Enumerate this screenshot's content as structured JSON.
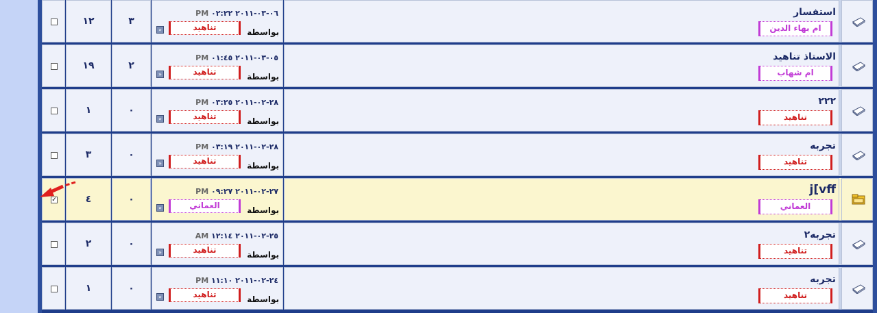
{
  "by_label": "بواسطة",
  "threads": [
    {
      "title": "استفسار",
      "author": "ام بهاء الدين",
      "author_color": "purple",
      "last_date": "٠٦-٠٣-٢٠١١ ٠٢:٢٢",
      "ampm": "PM",
      "last_poster": "تناهيد",
      "last_poster_color": "red",
      "views": "١٢",
      "replies": "٣",
      "checked": false,
      "highlighted": false,
      "icon": "thread-icon"
    },
    {
      "title": "الاستاذ تناهيد",
      "author": "ام شهاب",
      "author_color": "purple",
      "last_date": "٠٥-٠٣-٢٠١١ ٠١:٤٥",
      "ampm": "PM",
      "last_poster": "تناهيد",
      "last_poster_color": "red",
      "views": "١٩",
      "replies": "٢",
      "checked": false,
      "highlighted": false,
      "icon": "thread-icon"
    },
    {
      "title": "٢٢٢",
      "author": "تناهيد",
      "author_color": "red",
      "last_date": "٢٨-٠٢-٢٠١١ ٠٣:٢٥",
      "ampm": "PM",
      "last_poster": "تناهيد",
      "last_poster_color": "red",
      "views": "١",
      "replies": "٠",
      "checked": false,
      "highlighted": false,
      "icon": "thread-icon"
    },
    {
      "title": "تجربه",
      "author": "تناهيد",
      "author_color": "red",
      "last_date": "٢٨-٠٢-٢٠١١ ٠٣:١٩",
      "ampm": "PM",
      "last_poster": "تناهيد",
      "last_poster_color": "red",
      "views": "٣",
      "replies": "٠",
      "checked": false,
      "highlighted": false,
      "icon": "thread-icon"
    },
    {
      "title": "j[vff",
      "author": "العماني",
      "author_color": "purple",
      "last_date": "٢٧-٠٢-٢٠١١ ٠٩:٢٧",
      "ampm": "PM",
      "last_poster": "العماني",
      "last_poster_color": "purple",
      "views": "٤",
      "replies": "٠",
      "checked": true,
      "highlighted": true,
      "icon": "folder-icon"
    },
    {
      "title": "تجربه٢",
      "author": "تناهيد",
      "author_color": "red",
      "last_date": "٢٥-٠٢-٢٠١١ ١٢:١٤",
      "ampm": "AM",
      "last_poster": "تناهيد",
      "last_poster_color": "red",
      "views": "٢",
      "replies": "٠",
      "checked": false,
      "highlighted": false,
      "icon": "thread-icon"
    },
    {
      "title": "تجربه",
      "author": "تناهيد",
      "author_color": "red",
      "last_date": "٢٤-٠٢-٢٠١١ ١١:١٠",
      "ampm": "PM",
      "last_poster": "تناهيد",
      "last_poster_color": "red",
      "views": "١",
      "replies": "٠",
      "checked": false,
      "highlighted": false,
      "icon": "thread-icon"
    }
  ],
  "colors": {
    "frame": "#2d4e9c",
    "row_bg": "#eef1fa",
    "highlight_bg": "#fbf6cf",
    "red": "#d01e1e",
    "purple": "#c13bd6",
    "arrow": "#e0201e"
  }
}
